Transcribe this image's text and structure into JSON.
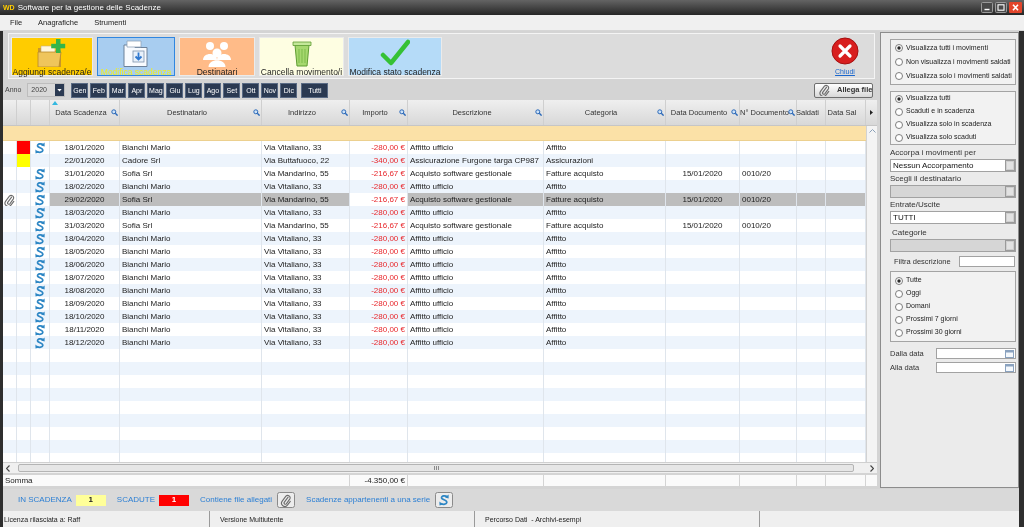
{
  "window": {
    "logo": "WD",
    "title": "Software per la gestione delle Scadenze"
  },
  "menu": [
    "File",
    "Anagrafiche",
    "Strumenti"
  ],
  "toolbar": [
    {
      "kind": "add",
      "label": "Aggiungi scadenza/e",
      "color": "#ffcc00",
      "selected": false
    },
    {
      "kind": "edit",
      "label": "Modifica scadenza",
      "color": "#a8cdf0",
      "selected": true
    },
    {
      "kind": "people",
      "label": "Destinatari",
      "color": "#ffbb88",
      "selected": false
    },
    {
      "kind": "bin",
      "label": "Cancella movimento/i",
      "color": "#fefee2",
      "selected": false
    },
    {
      "kind": "check",
      "label": "Modifica stato scadenza",
      "color": "#b5dbf8",
      "selected": false
    }
  ],
  "close_button": {
    "label": "Chiudi"
  },
  "year_selector": {
    "label": "Anno",
    "value": "2020"
  },
  "months": [
    "Gen",
    "Feb",
    "Mar",
    "Apr",
    "Mag",
    "Giu",
    "Lug",
    "Ago",
    "Set",
    "Ott",
    "Nov",
    "Dic"
  ],
  "all_months_button": "Tutti",
  "attach_button": "Allega file",
  "table": {
    "columns": [
      {
        "label": "Data Scadenza",
        "search": true,
        "sorted": true
      },
      {
        "label": "Destinatario",
        "search": true,
        "sorted": false
      },
      {
        "label": "Indirizzo",
        "search": true,
        "sorted": false
      },
      {
        "label": "Importo",
        "search": true,
        "sorted": false
      },
      {
        "label": "Descrizione",
        "search": true,
        "sorted": false
      },
      {
        "label": "Categoria",
        "search": true,
        "sorted": false
      },
      {
        "label": "Data Documento",
        "search": true,
        "sorted": false
      },
      {
        "label": "N° Documento",
        "search": true,
        "sorted": false
      },
      {
        "label": "Saldati",
        "search": false,
        "sorted": false
      },
      {
        "label": "Data Sal",
        "search": false,
        "sorted": false
      }
    ],
    "rows": [
      {
        "selected": false,
        "attachment": false,
        "overdue": true,
        "due": false,
        "series": true,
        "due_date": "18/01/2020",
        "recipient": "Bianchi Mario",
        "address": "Via Vitaliano, 33",
        "amount": "-280,00 €",
        "description": "Affitto ufficio",
        "category": "Affitto"
      },
      {
        "selected": false,
        "attachment": false,
        "overdue": false,
        "due": true,
        "series": false,
        "due_date": "22/01/2020",
        "recipient": "Cadore Srl",
        "address": "Via Buttafuoco, 22",
        "amount": "-340,00 €",
        "description": "Assicurazione Furgone targa CP987",
        "category": "Assicurazioni"
      },
      {
        "selected": false,
        "attachment": false,
        "overdue": false,
        "due": false,
        "series": true,
        "due_date": "31/01/2020",
        "recipient": "Sofia Srl",
        "address": "Via Mandarino, 55",
        "amount": "-216,67 €",
        "description": "Acquisto software gestionale",
        "category": "Fatture acquisto",
        "doc_date": "15/01/2020",
        "doc_number": "0010/20"
      },
      {
        "selected": false,
        "attachment": false,
        "overdue": false,
        "due": false,
        "series": true,
        "due_date": "18/02/2020",
        "recipient": "Bianchi Mario",
        "address": "Via Vitaliano, 33",
        "amount": "-280,00 €",
        "description": "Affitto ufficio",
        "category": "Affitto"
      },
      {
        "selected": true,
        "attachment": true,
        "overdue": false,
        "due": false,
        "series": true,
        "due_date": "29/02/2020",
        "recipient": "Sofia Srl",
        "address": "Via Mandarino, 55",
        "amount": "-216,67 €",
        "description": "Acquisto software gestionale",
        "category": "Fatture acquisto",
        "doc_date": "15/01/2020",
        "doc_number": "0010/20"
      },
      {
        "selected": false,
        "attachment": false,
        "overdue": false,
        "due": false,
        "series": true,
        "due_date": "18/03/2020",
        "recipient": "Bianchi Mario",
        "address": "Via Vitaliano, 33",
        "amount": "-280,00 €",
        "description": "Affitto ufficio",
        "category": "Affitto"
      },
      {
        "selected": false,
        "attachment": false,
        "overdue": false,
        "due": false,
        "series": true,
        "due_date": "31/03/2020",
        "recipient": "Sofia Srl",
        "address": "Via Mandarino, 55",
        "amount": "-216,67 €",
        "description": "Acquisto software gestionale",
        "category": "Fatture acquisto",
        "doc_date": "15/01/2020",
        "doc_number": "0010/20"
      },
      {
        "selected": false,
        "attachment": false,
        "overdue": false,
        "due": false,
        "series": true,
        "due_date": "18/04/2020",
        "recipient": "Bianchi Mario",
        "address": "Via Vitaliano, 33",
        "amount": "-280,00 €",
        "description": "Affitto ufficio",
        "category": "Affitto"
      },
      {
        "selected": false,
        "attachment": false,
        "overdue": false,
        "due": false,
        "series": true,
        "due_date": "18/05/2020",
        "recipient": "Bianchi Mario",
        "address": "Via Vitaliano, 33",
        "amount": "-280,00 €",
        "description": "Affitto ufficio",
        "category": "Affitto"
      },
      {
        "selected": false,
        "attachment": false,
        "overdue": false,
        "due": false,
        "series": true,
        "due_date": "18/06/2020",
        "recipient": "Bianchi Mario",
        "address": "Via Vitaliano, 33",
        "amount": "-280,00 €",
        "description": "Affitto ufficio",
        "category": "Affitto"
      },
      {
        "selected": false,
        "attachment": false,
        "overdue": false,
        "due": false,
        "series": true,
        "due_date": "18/07/2020",
        "recipient": "Bianchi Mario",
        "address": "Via Vitaliano, 33",
        "amount": "-280,00 €",
        "description": "Affitto ufficio",
        "category": "Affitto"
      },
      {
        "selected": false,
        "attachment": false,
        "overdue": false,
        "due": false,
        "series": true,
        "due_date": "18/08/2020",
        "recipient": "Bianchi Mario",
        "address": "Via Vitaliano, 33",
        "amount": "-280,00 €",
        "description": "Affitto ufficio",
        "category": "Affitto"
      },
      {
        "selected": false,
        "attachment": false,
        "overdue": false,
        "due": false,
        "series": true,
        "due_date": "18/09/2020",
        "recipient": "Bianchi Mario",
        "address": "Via Vitaliano, 33",
        "amount": "-280,00 €",
        "description": "Affitto ufficio",
        "category": "Affitto"
      },
      {
        "selected": false,
        "attachment": false,
        "overdue": false,
        "due": false,
        "series": true,
        "due_date": "18/10/2020",
        "recipient": "Bianchi Mario",
        "address": "Via Vitaliano, 33",
        "amount": "-280,00 €",
        "description": "Affitto ufficio",
        "category": "Affitto"
      },
      {
        "selected": false,
        "attachment": false,
        "overdue": false,
        "due": false,
        "series": true,
        "due_date": "18/11/2020",
        "recipient": "Bianchi Mario",
        "address": "Via Vitaliano, 33",
        "amount": "-280,00 €",
        "description": "Affitto ufficio",
        "category": "Affitto"
      },
      {
        "selected": false,
        "attachment": false,
        "overdue": false,
        "due": false,
        "series": true,
        "due_date": "18/12/2020",
        "recipient": "Bianchi Mario",
        "address": "Via Vitaliano, 33",
        "amount": "-280,00 €",
        "description": "Affitto ufficio",
        "category": "Affitto"
      }
    ]
  },
  "total": {
    "label": "Somma",
    "value": "-4.350,00 €"
  },
  "legend": [
    {
      "kind": "count",
      "label": "IN SCADENZA",
      "count": "1",
      "color": "#ffff99"
    },
    {
      "kind": "count",
      "label": "SCADUTE",
      "count": "1",
      "color": "#ff0000"
    },
    {
      "kind": "attachment",
      "label": "Contiene file allegati"
    },
    {
      "kind": "series",
      "label": "Scadenze appartenenti a una serie"
    }
  ],
  "status_bar": [
    "Licenza rilasciata a: Raff",
    "Versione Multiutente",
    "Percorso Dati  - Archivi-esempi"
  ],
  "filters": {
    "movements": [
      {
        "label": "Visualizza tutti i movimenti",
        "selected": true
      },
      {
        "label": "Non visualizza i movimenti saldati",
        "selected": false
      },
      {
        "label": "Visualizza solo i movimenti saldati",
        "selected": false
      }
    ],
    "due_state": [
      {
        "label": "Visualizza tutti",
        "selected": true
      },
      {
        "label": "Scaduti e in scadenza",
        "selected": false
      },
      {
        "label": "Visualizza solo in scadenza",
        "selected": false
      },
      {
        "label": "Visualizza solo scaduti",
        "selected": false
      }
    ],
    "dropdowns": [
      {
        "label": "Accorpa i movimenti per",
        "value": "Nessun Accorpamento",
        "disabled": false
      },
      {
        "label": "Scegli il destinatario",
        "disabled": true
      },
      {
        "label": "Entrate/Uscite",
        "value": "TUTTI",
        "disabled": false
      },
      {
        "label": "Categorie",
        "disabled": true
      }
    ],
    "description_filter": {
      "label": "Filtra descrizione"
    },
    "period": [
      {
        "label": "Tutte",
        "selected": true
      },
      {
        "label": "Oggi",
        "selected": false
      },
      {
        "label": "Domani",
        "selected": false
      },
      {
        "label": "Prossimi 7 giorni",
        "selected": false
      },
      {
        "label": "Prossimi 30 giorni",
        "selected": false
      }
    ],
    "date_fields": [
      {
        "label": "Dalla data"
      },
      {
        "label": "Alla data"
      }
    ]
  }
}
